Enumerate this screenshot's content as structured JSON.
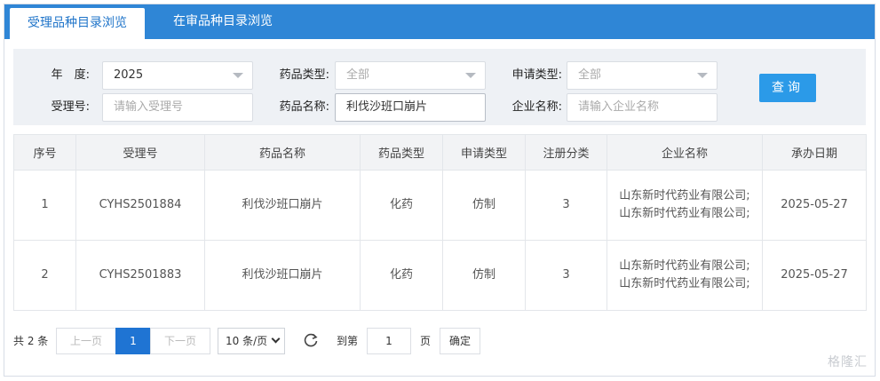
{
  "tabs": [
    {
      "label": "受理品种目录浏览",
      "active": true
    },
    {
      "label": "在审品种目录浏览",
      "active": false
    }
  ],
  "form": {
    "year_label": "年　度:",
    "year_value": "2025",
    "drug_type_label": "药品类型:",
    "drug_type_value": "全部",
    "apply_type_label": "申请类型:",
    "apply_type_value": "全部",
    "accept_no_label": "受理号:",
    "accept_no_placeholder": "请输入受理号",
    "drug_name_label": "药品名称:",
    "drug_name_value": "利伐沙班口崩片",
    "company_label": "企业名称:",
    "company_placeholder": "请输入企业名称",
    "query_label": "查询"
  },
  "table": {
    "headers": [
      "序号",
      "受理号",
      "药品名称",
      "药品类型",
      "申请类型",
      "注册分类",
      "企业名称",
      "承办日期"
    ],
    "rows": [
      [
        "1",
        "CYHS2501884",
        "利伐沙班口崩片",
        "化药",
        "仿制",
        "3",
        "山东新时代药业有限公司;山东新时代药业有限公司;",
        "2025-05-27"
      ],
      [
        "2",
        "CYHS2501883",
        "利伐沙班口崩片",
        "化药",
        "仿制",
        "3",
        "山东新时代药业有限公司;山东新时代药业有限公司;",
        "2025-05-27"
      ]
    ]
  },
  "pager": {
    "total": "共 2 条",
    "prev": "上一页",
    "current": "1",
    "next": "下一页",
    "page_size": "10 条/页",
    "goto_label": "到第",
    "goto_value": "1",
    "page_unit": "页",
    "confirm": "确定"
  },
  "watermark": "格隆汇"
}
